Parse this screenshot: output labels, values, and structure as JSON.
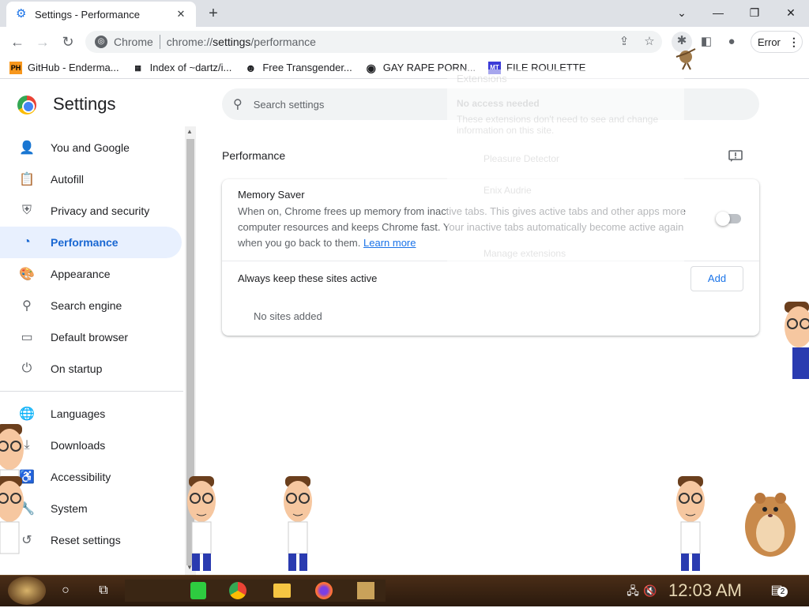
{
  "browser": {
    "tab_title": "Settings - Performance",
    "tab_close": "✕",
    "new_tab": "+",
    "window_controls": {
      "minimize": "—",
      "maximize": "❐",
      "close": "✕",
      "tab_search": "⌄"
    },
    "omnibox_chip": "Chrome",
    "url_host": "chrome://",
    "url_bold": "settings",
    "url_path": "/performance",
    "error_label": "Error"
  },
  "bookmarks": [
    {
      "icon": "PH",
      "label": "GitHub - Enderma...",
      "color": "#f7971d"
    },
    {
      "icon": "▦",
      "label": "Index of ~dartz/i...",
      "color": "#202124"
    },
    {
      "icon": "☻",
      "label": "Free Transgender...",
      "color": "#202124"
    },
    {
      "icon": "◉",
      "label": "GAY RAPE PORN...",
      "color": "#202124"
    },
    {
      "icon": "MT",
      "label": "FILE ROULETTE",
      "color": "#3b3bd8"
    }
  ],
  "settings": {
    "title": "Settings",
    "search_placeholder": "Search settings",
    "nav": [
      {
        "icon": "person-icon",
        "label": "You and Google"
      },
      {
        "icon": "clipboard-icon",
        "label": "Autofill"
      },
      {
        "icon": "shield-icon",
        "label": "Privacy and security"
      },
      {
        "icon": "speedometer-icon",
        "label": "Performance",
        "active": true
      },
      {
        "icon": "palette-icon",
        "label": "Appearance"
      },
      {
        "icon": "search-icon",
        "label": "Search engine"
      },
      {
        "icon": "browser-icon",
        "label": "Default browser"
      },
      {
        "icon": "power-icon",
        "label": "On startup"
      },
      {
        "icon": "globe-icon",
        "label": "Languages"
      },
      {
        "icon": "download-icon",
        "label": "Downloads"
      },
      {
        "icon": "accessibility-icon",
        "label": "Accessibility"
      },
      {
        "icon": "wrench-icon",
        "label": "System"
      },
      {
        "icon": "reset-icon",
        "label": "Reset settings"
      }
    ],
    "section_title": "Performance",
    "memory_saver": {
      "title": "Memory Saver",
      "description": "When on, Chrome frees up memory from inactive tabs. This gives active tabs and other apps more computer resources and keeps Chrome fast. Your inactive tabs automatically become active again when you go back to them.",
      "learn_more": "Learn more",
      "enabled": false
    },
    "keep_active_label": "Always keep these sites active",
    "add_button": "Add",
    "no_sites": "No sites added"
  },
  "extensions_popup": {
    "title": "Extensions",
    "subtitle": "No access needed",
    "desc": "These extensions don't need to see and change information on this site.",
    "items": [
      "Pleasure Detector",
      "Enix Audrie"
    ],
    "manage": "Manage extensions"
  },
  "taskbar": {
    "clock": "12:03 AM",
    "notification_count": "2"
  }
}
